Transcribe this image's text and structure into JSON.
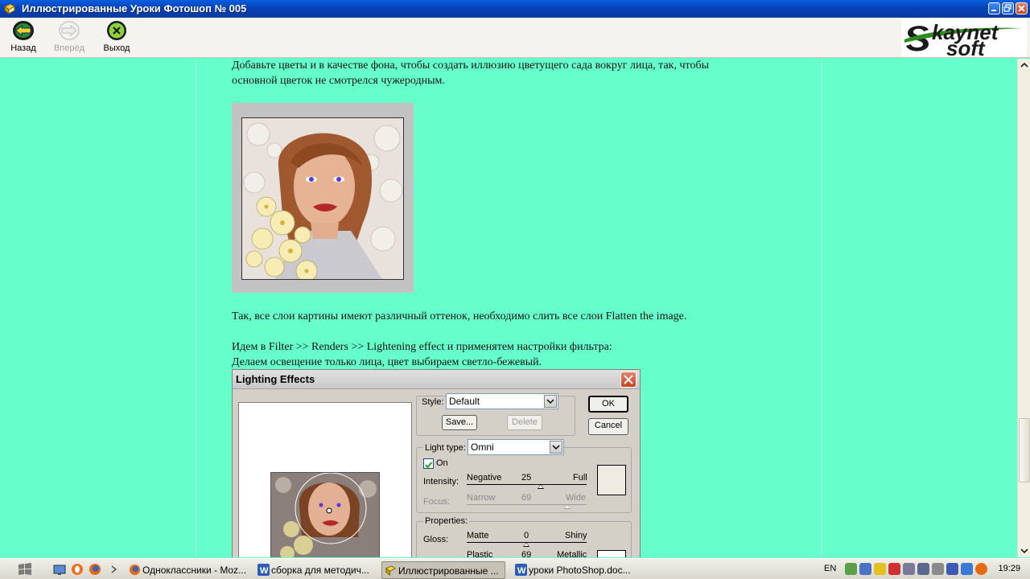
{
  "window": {
    "title": "Иллюстрированные Уроки Фотошоп № 005"
  },
  "toolbar": {
    "back_label": "Назад",
    "forward_label": "Вперёд",
    "exit_label": "Выход"
  },
  "logo": {
    "line1": "kaynet",
    "line2": "soft"
  },
  "content": {
    "para1_line1": "Добавьте цветы и в качестве фона, чтобы создать иллюзию цветущего сада вокруг лица, так, чтобы",
    "para1_line2": "основной цветок не смотрелся чужеродным.",
    "para2": "Так, все слои картины имеют различный оттенок, необходимо слить все слои Flatten the image.",
    "para3_line1": "Идем в Filter >> Renders >> Lightening effect и применятем настройки фильтра:",
    "para3_line2": "Делаем освещение только лица, цвет выбираем светло-бежевый."
  },
  "dialog": {
    "title": "Lighting Effects",
    "style_label": "Style:",
    "style_value": "Default",
    "save_label": "Save...",
    "delete_label": "Delete",
    "ok_label": "OK",
    "cancel_label": "Cancel",
    "light_type_label": "Light type:",
    "light_type_value": "Omni",
    "on_label": "On",
    "on_checked": true,
    "intensity_label": "Intensity:",
    "intensity_min": "Negative",
    "intensity_value": "25",
    "intensity_max": "Full",
    "focus_label": "Focus:",
    "focus_min": "Narrow",
    "focus_value": "69",
    "focus_max": "Wide",
    "properties_label": "Properties:",
    "gloss_label": "Gloss:",
    "gloss_min": "Matte",
    "gloss_value": "0",
    "gloss_max": "Shiny",
    "material_min": "Plastic",
    "material_value": "69",
    "material_max": "Metallic",
    "light_color": "#efebe2"
  },
  "taskbar": {
    "items": [
      {
        "label": "Одноклассники - Moz..."
      },
      {
        "label": "сборка для методич..."
      },
      {
        "label": "Иллюстрированные ..."
      },
      {
        "label": "уроки PhotoShop.doc..."
      }
    ],
    "lang": "EN",
    "clock": "19:29"
  }
}
